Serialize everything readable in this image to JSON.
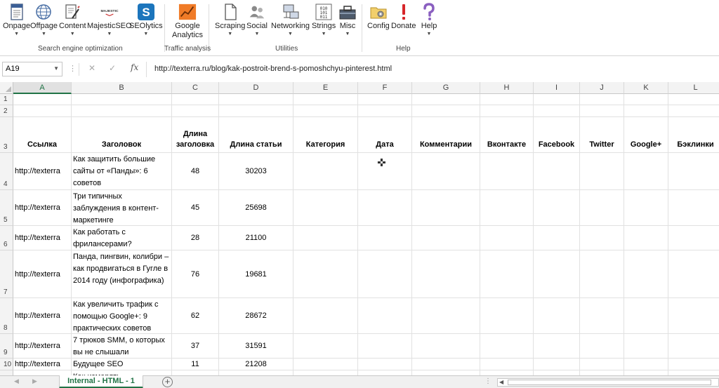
{
  "ribbon": {
    "buttons": [
      {
        "id": "onpage",
        "label": "Onpage",
        "has_caret": true,
        "icon": "document-icon"
      },
      {
        "id": "offpage",
        "label": "Offpage",
        "has_caret": true,
        "icon": "globe-icon"
      },
      {
        "id": "content",
        "label": "Content",
        "has_caret": true,
        "icon": "edit-document-icon"
      },
      {
        "id": "majesticseo",
        "label": "MajesticSEO",
        "has_caret": true,
        "icon": "majestic-logo-icon",
        "logo_text": "MAJESTIC"
      },
      {
        "id": "seolytics",
        "label": "SEOlytics",
        "has_caret": true,
        "icon": "seolytics-logo-icon",
        "logo_text": "S"
      },
      {
        "id": "google-analytics",
        "label": "Google\nAnalytics",
        "has_caret": false,
        "icon": "analytics-chart-icon"
      },
      {
        "id": "scraping",
        "label": "Scraping",
        "has_caret": true,
        "icon": "page-icon"
      },
      {
        "id": "social",
        "label": "Social",
        "has_caret": true,
        "icon": "people-icon"
      },
      {
        "id": "networking",
        "label": "Networking",
        "has_caret": true,
        "icon": "network-icon"
      },
      {
        "id": "strings",
        "label": "Strings",
        "has_caret": true,
        "icon": "binary-icon"
      },
      {
        "id": "misc",
        "label": "Misc",
        "has_caret": true,
        "icon": "toolbox-icon"
      },
      {
        "id": "config",
        "label": "Config",
        "has_caret": false,
        "icon": "folder-gear-icon"
      },
      {
        "id": "donate",
        "label": "Donate",
        "has_caret": false,
        "icon": "exclamation-icon"
      },
      {
        "id": "help",
        "label": "Help",
        "has_caret": true,
        "icon": "question-icon"
      }
    ],
    "groups": [
      "Search engine optimization",
      "Traffic analysis",
      "Utilities",
      "Help"
    ]
  },
  "formula_bar": {
    "name_box": "A19",
    "formula": "http://texterra.ru/blog/kak-postroit-brend-s-pomoshchyu-pinterest.html"
  },
  "sheet": {
    "columns": [
      "A",
      "B",
      "C",
      "D",
      "E",
      "F",
      "G",
      "H",
      "I",
      "J",
      "K",
      "L"
    ],
    "row_numbers": [
      "1",
      "2",
      "3",
      "4",
      "5",
      "6",
      "7",
      "8",
      "9",
      "10"
    ],
    "headers": [
      "Ссылка",
      "Заголовок",
      "Длина заголовка",
      "Длина статьи",
      "Категория",
      "Дата",
      "Комментарии",
      "Вконтакте",
      "Facebook",
      "Twitter",
      "Google+",
      "Бэклинки"
    ],
    "rows": [
      {
        "link": "http://texterra",
        "title": "Как защитить большие сайты от «Панды»: 6 советов",
        "title_len": "48",
        "article_len": "30203"
      },
      {
        "link": "http://texterra",
        "title": "Три типичных заблуждения в контент-маркетинге",
        "title_len": "45",
        "article_len": "25698"
      },
      {
        "link": "http://texterra",
        "title": "Как работать с фрилансерами?",
        "title_len": "28",
        "article_len": "21100"
      },
      {
        "link": "http://texterra",
        "title": "Панда, пингвин, колибри – как продвигаться в Гугле в 2014 году (инфографика)",
        "title_len": "76",
        "article_len": "19681"
      },
      {
        "link": "http://texterra",
        "title": "Как увеличить трафик с помощью Google+: 9 практических советов",
        "title_len": "62",
        "article_len": "28672"
      },
      {
        "link": "http://texterra",
        "title": "7 трюков SMM, о которых вы не слышали",
        "title_len": "37",
        "article_len": "31591"
      },
      {
        "link": "http://texterra",
        "title": "Будущее SEO",
        "title_len": "11",
        "article_len": "21208"
      }
    ],
    "partial_row_title": "Как измерять"
  },
  "tabs": {
    "active": "Internal - HTML - 1",
    "add_label": "+"
  },
  "colors": {
    "excel_green": "#217346",
    "header_bg": "#f3f3f3",
    "gridline": "#e1e1e1"
  }
}
